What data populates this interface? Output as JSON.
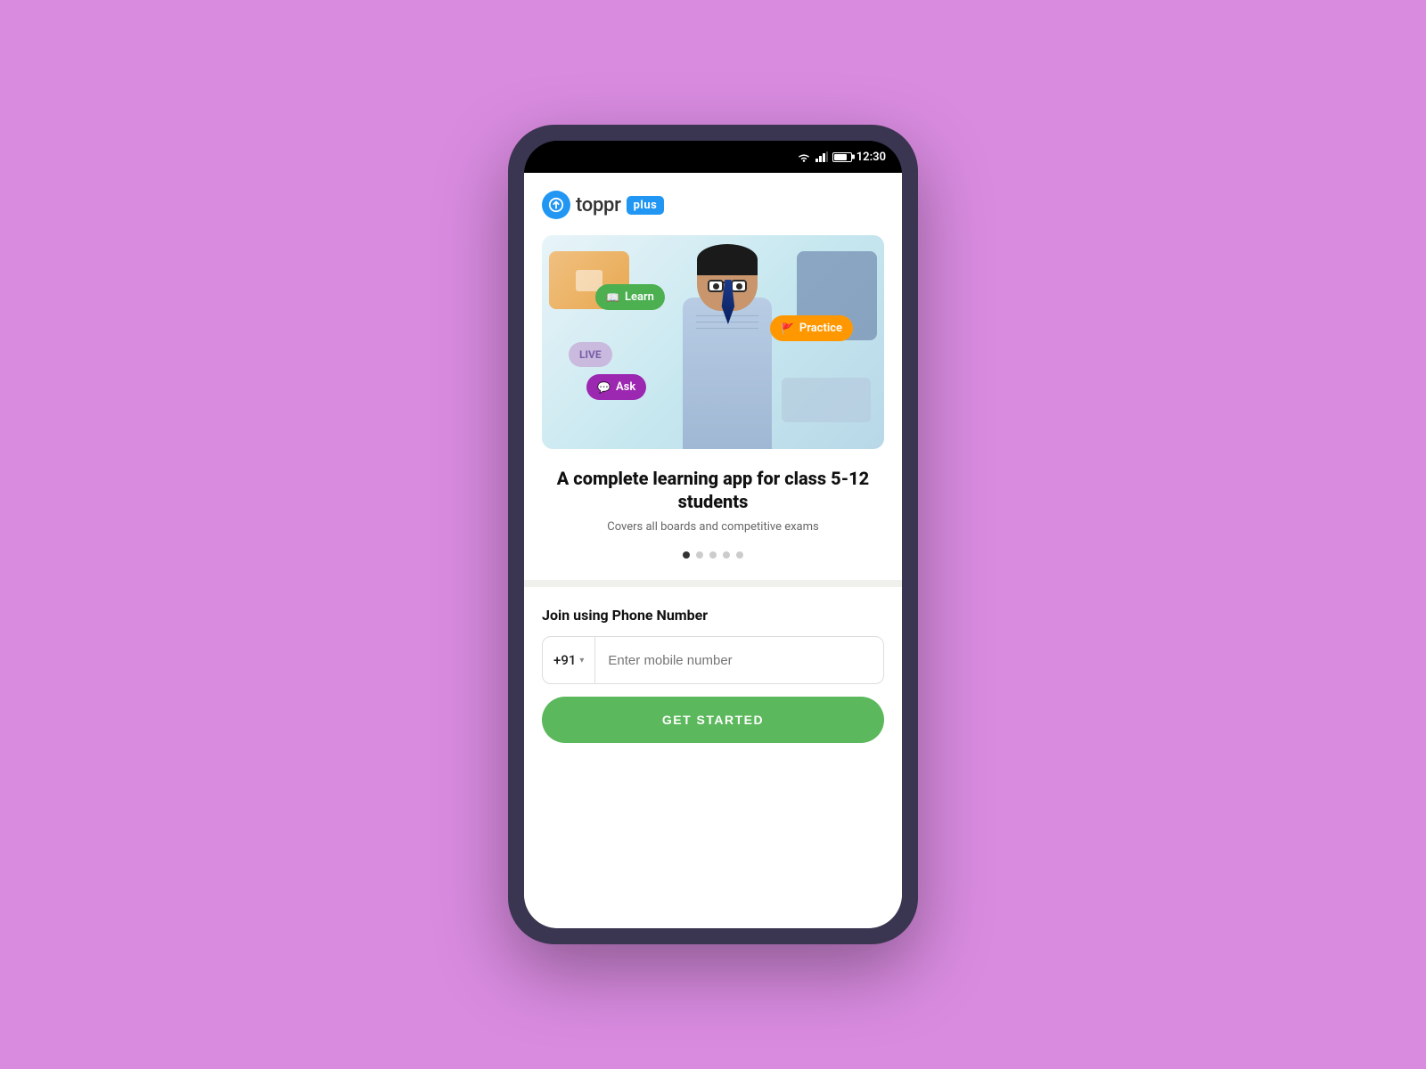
{
  "status_bar": {
    "time": "12:30"
  },
  "logo": {
    "brand_name": "toppr",
    "plus_label": "plus"
  },
  "hero": {
    "badge_learn": "Learn",
    "badge_practice": "Practice",
    "badge_live": "LIVE",
    "badge_ask": "Ask"
  },
  "headline": {
    "title": "A complete learning app for class 5-12 students",
    "subtitle": "Covers all boards and competitive exams"
  },
  "carousel": {
    "total_dots": 5,
    "active_dot": 0
  },
  "join_section": {
    "title": "Join using Phone Number",
    "country_code": "+91",
    "phone_placeholder": "Enter mobile number",
    "cta_label": "GET STARTED"
  },
  "colors": {
    "green": "#4CAF50",
    "orange": "#FF9800",
    "purple": "#9C27B0",
    "blue": "#2196F3",
    "cta_green": "#5cb85c"
  }
}
